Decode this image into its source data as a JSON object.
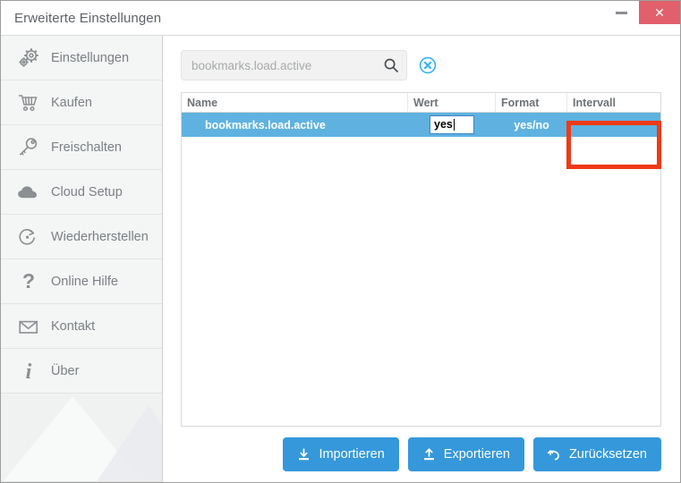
{
  "window": {
    "title": "Erweiterte Einstellungen",
    "minimize_label": "—",
    "close_label": "✕"
  },
  "sidebar": {
    "items": [
      {
        "label": "Einstellungen",
        "icon": "gears-icon",
        "name": "sidebar-item-einstellungen"
      },
      {
        "label": "Kaufen",
        "icon": "cart-icon",
        "name": "sidebar-item-kaufen"
      },
      {
        "label": "Freischalten",
        "icon": "key-icon",
        "name": "sidebar-item-freischalten"
      },
      {
        "label": "Cloud Setup",
        "icon": "cloud-icon",
        "name": "sidebar-item-cloud-setup"
      },
      {
        "label": "Wiederherstellen",
        "icon": "restore-icon",
        "name": "sidebar-item-wiederherstellen"
      },
      {
        "label": "Online Hilfe",
        "icon": "question-mark-icon",
        "name": "sidebar-item-online-hilfe"
      },
      {
        "label": "Kontakt",
        "icon": "envelope-icon",
        "name": "sidebar-item-kontakt"
      },
      {
        "label": "Über",
        "icon": "info-icon",
        "name": "sidebar-item-ueber"
      }
    ]
  },
  "search": {
    "value": "bookmarks.load.active",
    "placeholder": "bookmarks.load.active",
    "search_icon": "search-icon",
    "clear_icon": "clear-circle-icon"
  },
  "table": {
    "columns": [
      "Name",
      "Wert",
      "Format",
      "Intervall"
    ],
    "rows": [
      {
        "name": "bookmarks.load.active",
        "wert": "yes",
        "format": "yes/no",
        "intervall": ""
      }
    ],
    "editing": {
      "column": "Wert",
      "value": "yes",
      "active": true
    }
  },
  "footer": {
    "buttons": [
      {
        "label": "Importieren",
        "icon": "import-icon",
        "name": "import-button"
      },
      {
        "label": "Exportieren",
        "icon": "export-icon",
        "name": "export-button"
      },
      {
        "label": "Zurücksetzen",
        "icon": "reset-icon",
        "name": "reset-button"
      }
    ]
  },
  "colors": {
    "accent_blue": "#3498db",
    "row_selected": "#5fb2e0",
    "close_red": "#e2606b",
    "annotation_red": "#ef3a16",
    "sidebar_bg": "#f4f5f5",
    "text_gray": "#7b8085"
  }
}
